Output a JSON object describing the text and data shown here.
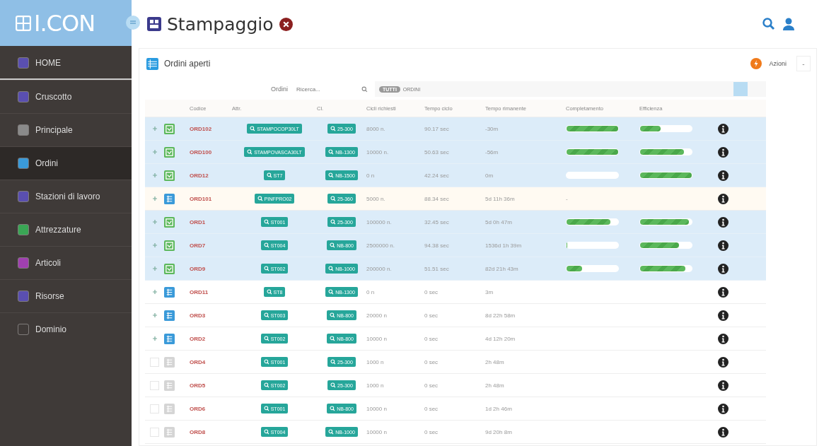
{
  "logo": "I.CON",
  "page_title": "Stampaggio",
  "sidebar": {
    "items": [
      {
        "label": "HOME",
        "selected": false,
        "color": "#5a4fb0"
      },
      {
        "label": "Cruscotto",
        "selected": false,
        "color": "#5a4fb0"
      },
      {
        "label": "Principale",
        "selected": false,
        "color": "#8a8a8a"
      },
      {
        "label": "Ordini",
        "selected": true,
        "color": "#3a9ad9"
      },
      {
        "label": "Stazioni di lavoro",
        "selected": false,
        "color": "#5a4fb0"
      },
      {
        "label": "Attrezzature",
        "selected": false,
        "color": "#3aa655"
      },
      {
        "label": "Articoli",
        "selected": false,
        "color": "#a040b0"
      },
      {
        "label": "Risorse",
        "selected": false,
        "color": "#5a4fb0"
      },
      {
        "label": "Dominio",
        "selected": false,
        "color": "#3f3a38"
      }
    ]
  },
  "panel": {
    "title": "Ordini aperti",
    "actions_label": "Azioni",
    "dropdown_label": "-"
  },
  "filter": {
    "label": "Ordini",
    "placeholder": "Ricerca...",
    "tags": [
      "TUTTI",
      "ORDINI"
    ]
  },
  "table": {
    "columns": [
      "Codice",
      "Attr.",
      "Cl.",
      "Cicli richiesti",
      "Tempo ciclo",
      "Tempo rimanente",
      "Completamento",
      "Efficienza"
    ],
    "rows": [
      {
        "expandable": true,
        "kind": "done",
        "selected": true,
        "hovered": false,
        "code": "ORD102",
        "attr": "STAMPOCOP30LT",
        "cl": "25-300",
        "cicli": "8000 n.",
        "tempo": "90.17 sec",
        "rimanente": "-30m",
        "completion": {
          "level": 1.0
        },
        "efficiency": {
          "level": 0.4
        }
      },
      {
        "expandable": true,
        "kind": "done",
        "selected": true,
        "hovered": false,
        "code": "ORD100",
        "attr": "STAMPOVASCA30LT",
        "cl": "NB-1300",
        "cicli": "10000 n.",
        "tempo": "50.63 sec",
        "rimanente": "-56m",
        "completion": {
          "level": 1.0
        },
        "efficiency": {
          "level": 0.85
        }
      },
      {
        "expandable": true,
        "kind": "done",
        "selected": true,
        "hovered": false,
        "code": "ORD12",
        "attr": "ST7",
        "cl": "NB-1500",
        "cicli": "0 n",
        "tempo": "42.24 sec",
        "rimanente": "0m",
        "completion": {
          "level": 0
        },
        "efficiency": {
          "level": 1.0
        }
      },
      {
        "expandable": true,
        "kind": "active",
        "selected": false,
        "hovered": true,
        "code": "ORD101",
        "attr": "PINFPRO02",
        "cl": "25-360",
        "cicli": "5000 n.",
        "tempo": "88.34 sec",
        "rimanente": "5d 11h 36m",
        "completion_text": "-"
      },
      {
        "expandable": true,
        "kind": "done",
        "selected": true,
        "hovered": false,
        "code": "ORD1",
        "attr": "ST001",
        "cl": "25-300",
        "cicli": "100000 n.",
        "tempo": "32.45 sec",
        "rimanente": "5d 0h 47m",
        "completion": {
          "level": 0.85
        },
        "efficiency": {
          "level": 0.95
        }
      },
      {
        "expandable": true,
        "kind": "done",
        "selected": true,
        "hovered": false,
        "code": "ORD7",
        "attr": "ST004",
        "cl": "NB-800",
        "cicli": "2500000 n.",
        "tempo": "94.38 sec",
        "rimanente": "1536d 1h 39m",
        "completion": {
          "level": 0.02
        },
        "efficiency": {
          "level": 0.75
        }
      },
      {
        "expandable": true,
        "kind": "done",
        "selected": true,
        "hovered": false,
        "code": "ORD9",
        "attr": "ST002",
        "cl": "NB-1000",
        "cicli": "200000 n.",
        "tempo": "51.51 sec",
        "rimanente": "82d 21h 43m",
        "completion": {
          "level": 0.3
        },
        "efficiency": {
          "level": 0.88
        }
      },
      {
        "expandable": true,
        "kind": "active",
        "selected": false,
        "hovered": false,
        "code": "ORD11",
        "attr": "ST8",
        "cl": "NB-1300",
        "cicli": "0 n",
        "tempo": "0 sec",
        "rimanente": "3m"
      },
      {
        "expandable": true,
        "kind": "active",
        "selected": false,
        "hovered": false,
        "code": "ORD3",
        "attr": "ST003",
        "cl": "NB-800",
        "cicli": "20000 n",
        "tempo": "0 sec",
        "rimanente": "8d 22h 58m"
      },
      {
        "expandable": true,
        "kind": "active",
        "selected": false,
        "hovered": false,
        "code": "ORD2",
        "attr": "ST002",
        "cl": "NB-800",
        "cicli": "10000 n",
        "tempo": "0 sec",
        "rimanente": "4d 12h 20m"
      },
      {
        "expandable": false,
        "kind": "idle",
        "selected": false,
        "hovered": false,
        "code": "ORD4",
        "attr": "ST001",
        "cl": "25-300",
        "cicli": "1000 n",
        "tempo": "0 sec",
        "rimanente": "2h 48m"
      },
      {
        "expandable": false,
        "kind": "idle",
        "selected": false,
        "hovered": false,
        "code": "ORD5",
        "attr": "ST002",
        "cl": "25-300",
        "cicli": "1000 n",
        "tempo": "0 sec",
        "rimanente": "2h 48m"
      },
      {
        "expandable": false,
        "kind": "idle",
        "selected": false,
        "hovered": false,
        "code": "ORD6",
        "attr": "ST001",
        "cl": "NB-800",
        "cicli": "10000 n",
        "tempo": "0 sec",
        "rimanente": "1d 2h 46m"
      },
      {
        "expandable": false,
        "kind": "idle",
        "selected": false,
        "hovered": false,
        "code": "ORD8",
        "attr": "ST004",
        "cl": "NB-1000",
        "cicli": "10000 n",
        "tempo": "0 sec",
        "rimanente": "9d 20h 8m"
      }
    ]
  }
}
